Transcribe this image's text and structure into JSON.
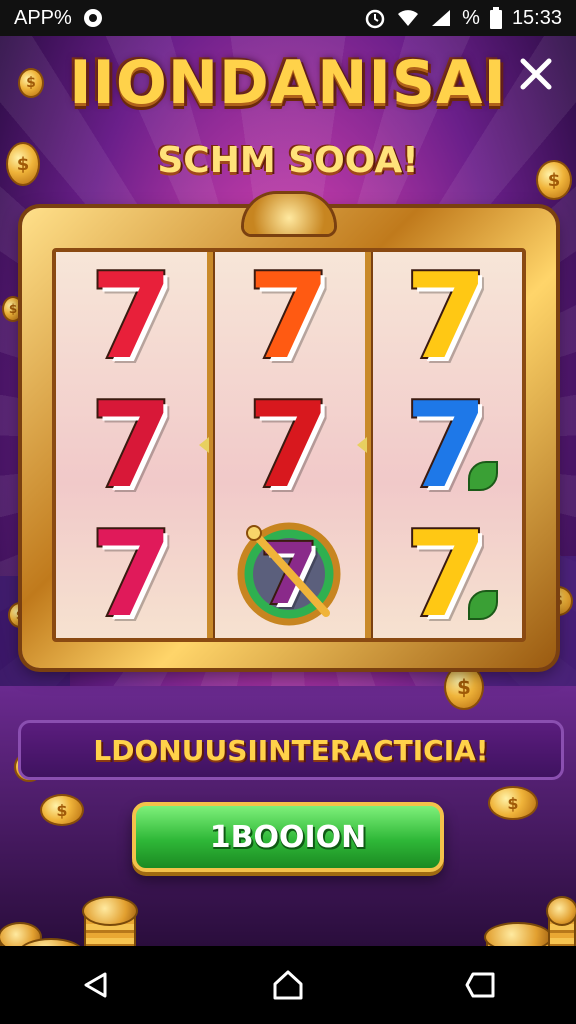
{
  "status_bar": {
    "app_label": "APP%",
    "time": "15:33",
    "battery_text": "%",
    "icons": [
      "notification-app-icon",
      "alarm-icon",
      "wifi-icon",
      "signal-icon",
      "battery-icon"
    ]
  },
  "header": {
    "title": "IIONDANISAI",
    "subtitle": "SCHM SOOA!",
    "close_icon": "close-icon"
  },
  "reels": [
    {
      "symbols": [
        {
          "glyph": "7",
          "color": "#e8203a",
          "accent": "#1d9a3a"
        },
        {
          "glyph": "7",
          "color": "#d81838",
          "accent": "#f0a020"
        },
        {
          "glyph": "7",
          "color": "#e01a5a",
          "accent": "#3aa035"
        }
      ]
    },
    {
      "symbols": [
        {
          "glyph": "7",
          "color": "#ff5a12",
          "accent": "#ffb020"
        },
        {
          "glyph": "7",
          "color": "#d8181e",
          "accent": "#ff9a20"
        },
        {
          "glyph": "7",
          "color": "#8a2a8a",
          "accent": "#2fb050",
          "crossed": true
        }
      ]
    },
    {
      "symbols": [
        {
          "glyph": "7",
          "color": "#ffc814",
          "accent": "#c07a10"
        },
        {
          "glyph": "7",
          "color": "#1e78e8",
          "accent": "#3aa035"
        },
        {
          "glyph": "7",
          "color": "#ffc814",
          "accent": "#3aa035"
        }
      ]
    }
  ],
  "banner_text": "LDONUUSIINTERACTICIA!",
  "cta_label": "1BOOION",
  "coin_symbol": "$",
  "nav": [
    "back-icon",
    "home-icon",
    "recents-icon"
  ],
  "colors": {
    "title_gold": "#ffd24a",
    "frame_gold": "#c07a1c",
    "cta_green": "#2fb838",
    "banner_purple": "#5b1d7e"
  }
}
